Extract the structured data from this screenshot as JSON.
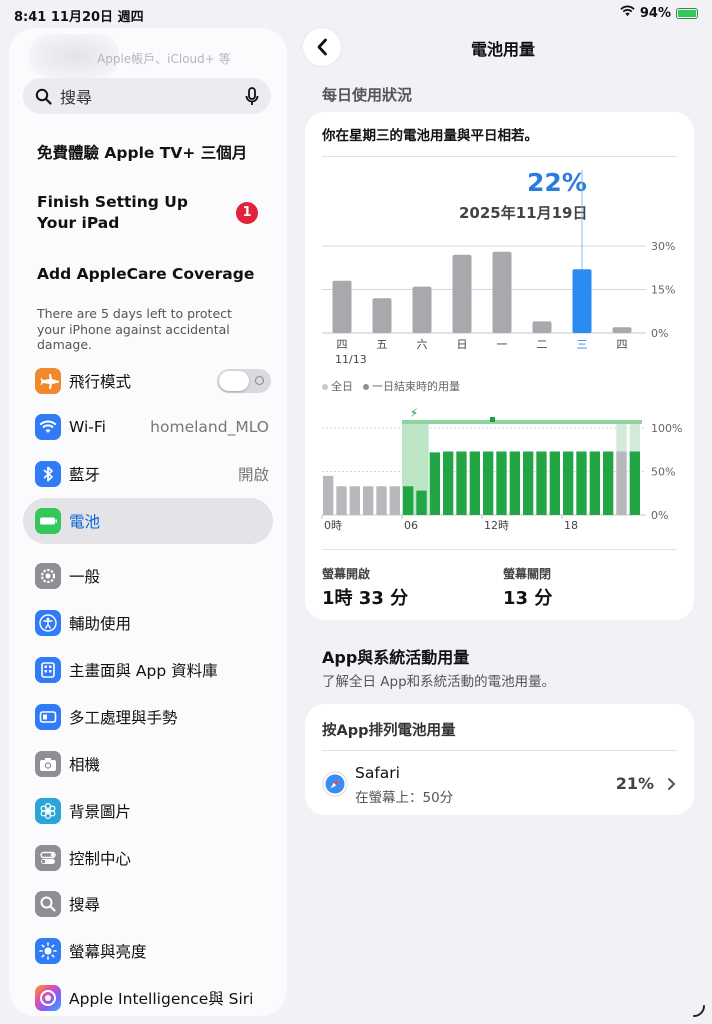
{
  "status_bar": {
    "time": "8:41",
    "date": "11月20日 週四",
    "battery": "94%"
  },
  "sidebar": {
    "account_subtitle": "Apple帳戶、iCloud+ 等",
    "search_placeholder": "搜尋",
    "promo_appletv": "免費體驗 Apple TV+ 三個月",
    "setup_label": "Finish Setting Up Your iPad",
    "setup_badge": "1",
    "applecare_title": "Add AppleCare Coverage",
    "applecare_note": "There are 5 days left to protect your iPhone against accidental damage.",
    "items": [
      {
        "label": "飛行模式",
        "icon": "airplane-icon",
        "color": "#f0892b",
        "value": "",
        "toggle": true
      },
      {
        "label": "Wi-Fi",
        "icon": "wifi-icon",
        "color": "#2f7cf6",
        "value": "homeland_MLO"
      },
      {
        "label": "藍牙",
        "icon": "bluetooth-icon",
        "color": "#2f7cf6",
        "value": "開啟"
      },
      {
        "label": "電池",
        "icon": "battery-icon",
        "color": "#34c759",
        "value": "",
        "selected": true
      },
      {
        "label": "一般",
        "icon": "gear-icon",
        "color": "#8e8e93",
        "value": ""
      },
      {
        "label": "輔助使用",
        "icon": "accessibility-icon",
        "color": "#2f7cf6",
        "value": ""
      },
      {
        "label": "主畫面與 App 資料庫",
        "icon": "home-screen-icon",
        "color": "#2f7cf6",
        "value": ""
      },
      {
        "label": "多工處理與手勢",
        "icon": "multitasking-icon",
        "color": "#2f7cf6",
        "value": ""
      },
      {
        "label": "相機",
        "icon": "camera-icon",
        "color": "#8e8e93",
        "value": ""
      },
      {
        "label": "背景圖片",
        "icon": "wallpaper-icon",
        "color": "#2aa6d6",
        "value": ""
      },
      {
        "label": "控制中心",
        "icon": "control-center-icon",
        "color": "#8e8e93",
        "value": ""
      },
      {
        "label": "搜尋",
        "icon": "search-icon",
        "color": "#8e8e93",
        "value": ""
      },
      {
        "label": "螢幕與亮度",
        "icon": "brightness-icon",
        "color": "#2f7cf6",
        "value": ""
      },
      {
        "label": "Apple Intelligence與 Siri",
        "icon": "siri-icon",
        "color": "#c45be0",
        "value": ""
      }
    ]
  },
  "main": {
    "nav_title": "電池用量",
    "section_daily": "每日使用狀況",
    "card_heading": "你在星期三的電池用量與平日相若。",
    "selected_pct": "22%",
    "selected_date": "2025年11月19日",
    "legend_all": "全日",
    "legend_end": "一日結束時的用量",
    "screen_on_label": "螢幕開啟",
    "screen_on_value": "1時 33 分",
    "screen_off_label": "螢幕關閉",
    "screen_off_value": "13 分",
    "app_section_title": "App與系統活動用量",
    "app_section_sub": "了解全日 App和系統活動的電池用量。",
    "by_app_heading": "按App排列電池用量",
    "app_name": "Safari",
    "app_detail": "在螢幕上：50分",
    "app_pct": "21%"
  },
  "chart_data": [
    {
      "type": "bar",
      "title": "",
      "categories": [
        "四",
        "五",
        "六",
        "日",
        "一",
        "二",
        "三",
        "四"
      ],
      "first_category_sublabel": "11/13",
      "values": [
        18,
        12,
        16,
        27,
        28,
        4,
        22,
        2
      ],
      "selected_index": 6,
      "ylim": [
        0,
        30
      ],
      "y_ticks": [
        "30%",
        "15%",
        "0%"
      ],
      "grid": true,
      "colors": {
        "default": "#a9a9ad",
        "selected": "#2a8bf2"
      }
    },
    {
      "type": "bar",
      "title": "",
      "x_tick_labels": [
        "0時",
        "06",
        "12時",
        "18"
      ],
      "x_tick_positions": [
        0,
        6,
        12,
        18
      ],
      "hours": [
        0,
        1,
        2,
        3,
        4,
        5,
        6,
        7,
        8,
        9,
        10,
        11,
        12,
        13,
        14,
        15,
        16,
        17,
        18,
        19,
        20,
        21,
        22,
        23
      ],
      "values": [
        45,
        33,
        33,
        33,
        33,
        33,
        33,
        28,
        72,
        73,
        73,
        73,
        73,
        73,
        73,
        73,
        73,
        73,
        73,
        73,
        73,
        73,
        73,
        73
      ],
      "states": [
        "g",
        "g",
        "g",
        "g",
        "g",
        "g",
        "c",
        "c",
        "c",
        "c",
        "c",
        "c",
        "c",
        "c",
        "c",
        "c",
        "c",
        "c",
        "c",
        "c",
        "c",
        "c",
        "g",
        "c"
      ],
      "ylim": [
        0,
        100
      ],
      "y_ticks": [
        "100%",
        "50%",
        "0%"
      ],
      "grid": true,
      "colors": {
        "battery": "#22a545",
        "no_charge": "#b8b8bc",
        "charge_band": "#bde6c6"
      }
    }
  ]
}
